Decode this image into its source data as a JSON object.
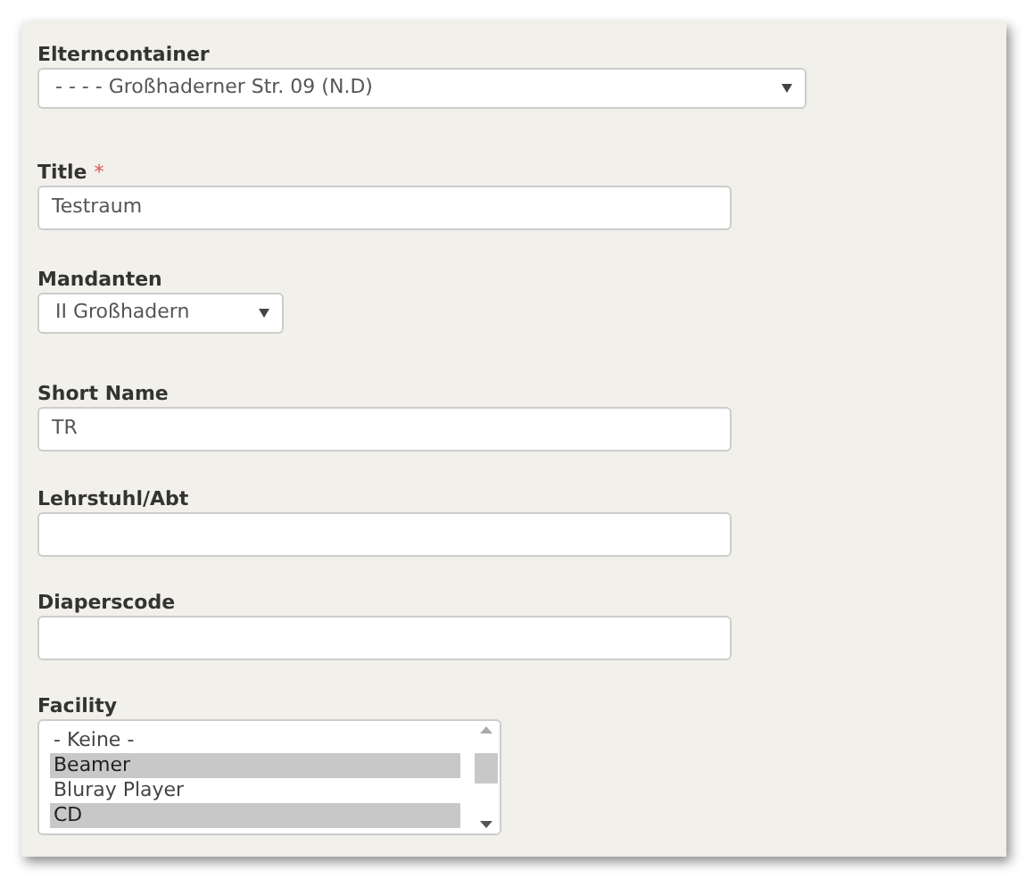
{
  "fields": [
    {
      "kind": "select",
      "label": "Elterncontainer",
      "value": "- - - - Großhaderner Str. 09 (N.D)"
    },
    {
      "kind": "text",
      "label": "Title",
      "required_mark": "*",
      "value": "Testraum"
    },
    {
      "kind": "select",
      "label": "Mandanten",
      "value": "II Großhadern"
    },
    {
      "kind": "text",
      "label": "Short Name",
      "value": "TR"
    },
    {
      "kind": "text",
      "label": "Lehrstuhl/Abt"
    },
    {
      "kind": "text",
      "label": "Diaperscode"
    },
    {
      "kind": "listbox",
      "label": "Facility",
      "options": [
        {
          "label": "- Keine -",
          "selected": false
        },
        {
          "label": "Beamer",
          "selected": true
        },
        {
          "label": "Bluray Player",
          "selected": false
        },
        {
          "label": "CD",
          "selected": true
        }
      ]
    }
  ]
}
